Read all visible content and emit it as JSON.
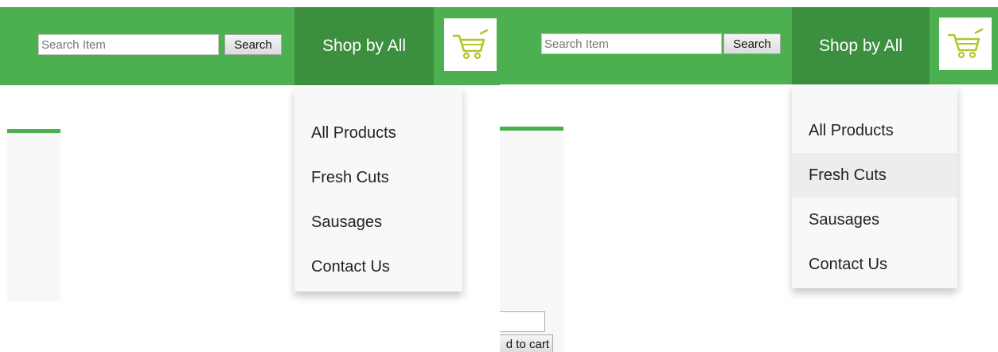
{
  "colors": {
    "header_green": "#4caf50",
    "tab_dark_green": "#3c8f3f",
    "cart_icon": "#b5c52c",
    "dropdown_bg": "#f8f8f8",
    "dropdown_hover": "#ededed"
  },
  "left": {
    "search": {
      "placeholder": "Search Item",
      "button_label": "Search"
    },
    "nav": {
      "shop_label": "Shop by All",
      "cart_icon": "shopping-cart-icon"
    },
    "dropdown": {
      "items": [
        {
          "label": "All Products"
        },
        {
          "label": "Fresh Cuts"
        },
        {
          "label": "Sausages"
        },
        {
          "label": "Contact Us"
        }
      ]
    }
  },
  "right": {
    "search": {
      "placeholder": "Search Item",
      "button_label": "Search"
    },
    "nav": {
      "shop_label": "Shop by All",
      "cart_icon": "shopping-cart-icon"
    },
    "dropdown": {
      "hovered_item": "Fresh Cuts",
      "items": [
        {
          "label": "All Products"
        },
        {
          "label": "Fresh Cuts"
        },
        {
          "label": "Sausages"
        },
        {
          "label": "Contact Us"
        }
      ]
    },
    "product": {
      "add_to_cart_label": "d to cart"
    }
  }
}
